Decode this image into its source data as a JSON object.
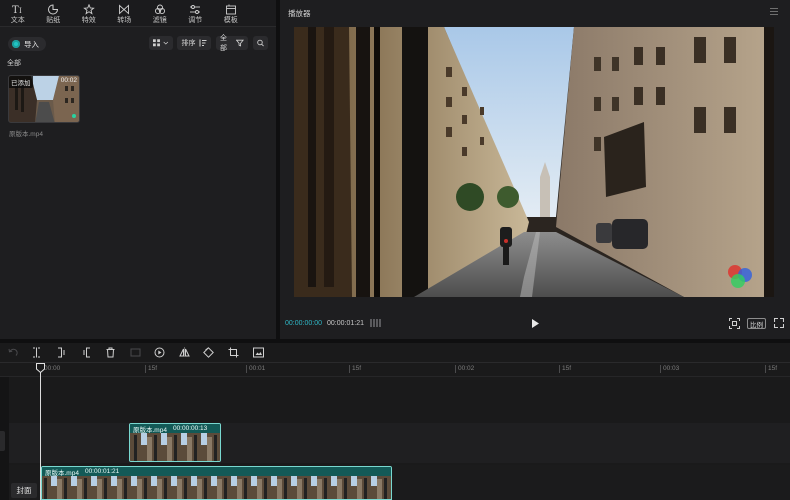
{
  "colors": {
    "accent": "#20c5c5",
    "time_current": "#2fb7c6",
    "panel_bg": "#1e1e20",
    "clip_border": "#79d8d0",
    "clip_header": "#135a57"
  },
  "top_tabs": [
    {
      "label": "文本",
      "icon": "text-icon"
    },
    {
      "label": "贴纸",
      "icon": "sticker-icon"
    },
    {
      "label": "特效",
      "icon": "effects-icon"
    },
    {
      "label": "转场",
      "icon": "transition-icon"
    },
    {
      "label": "滤镜",
      "icon": "filter-icon"
    },
    {
      "label": "调节",
      "icon": "adjust-icon"
    },
    {
      "label": "模板",
      "icon": "template-icon"
    }
  ],
  "media": {
    "import_label": "导入",
    "sort_label": "排序",
    "filter_label": "全部",
    "all_label": "全部",
    "item": {
      "badge": "已添加",
      "duration": "00:02",
      "filename": "原版本.mp4"
    }
  },
  "player": {
    "title": "播放器",
    "time_current": "00:00:00:00",
    "time_total": "00:00:01:21",
    "ratio_label": "比例"
  },
  "timeline": {
    "ruler_labels": [
      "00:00",
      "15f",
      "00:01",
      "15f",
      "00:02",
      "15f",
      "00:03",
      "15f"
    ],
    "cover_label": "封面",
    "clips": [
      {
        "name": "原版本.mp4",
        "duration": "00:00:00:13"
      },
      {
        "name": "原版本.mp4",
        "duration": "00:00:01:21"
      }
    ]
  }
}
